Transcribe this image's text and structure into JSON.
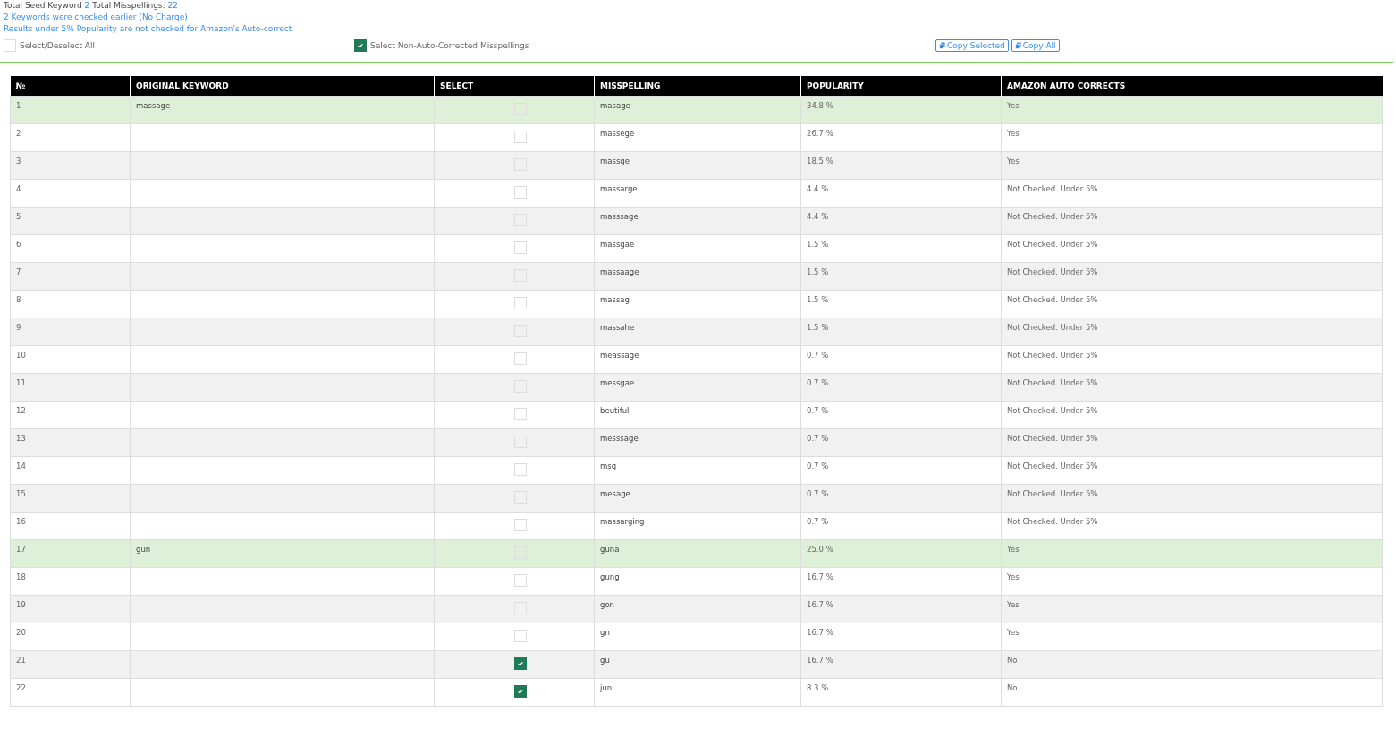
{
  "summary": {
    "seed_label": "Total Seed Keyword",
    "seed_count": "2",
    "total_label": "Total Misspellings:",
    "total_count": "22"
  },
  "notes": [
    "2 Keywords were checked earlier (No Charge)",
    "Results under 5% Popularity are not checked for Amazon's Auto-correct"
  ],
  "controls": {
    "select_all": {
      "label": "Select/Deselect All",
      "checked": false
    },
    "select_non_auto": {
      "label": "Select Non-Auto-Corrected Misspellings",
      "checked": true
    },
    "buttons": [
      "Copy Selected",
      "Copy All"
    ]
  },
  "table": {
    "columns": [
      "№",
      "ORIGINAL KEYWORD",
      "SELECT",
      "MISSPELLING",
      "POPULARITY",
      "AMAZON AUTO CORRECTS"
    ],
    "rows": [
      {
        "no": "1",
        "keyword": "massage",
        "checked": false,
        "misspelling": "masage",
        "popularity": "34.8 %",
        "auto_corrects": "Yes",
        "highlighted": true
      },
      {
        "no": "2",
        "checked": false,
        "misspelling": "massege",
        "popularity": "26.7 %",
        "auto_corrects": "Yes",
        "highlighted": false
      },
      {
        "no": "3",
        "checked": false,
        "misspelling": "massge",
        "popularity": "18.5 %",
        "auto_corrects": "Yes",
        "highlighted": false
      },
      {
        "no": "4",
        "checked": false,
        "misspelling": "massarge",
        "popularity": "4.4 %",
        "auto_corrects": "Not Checked. Under 5%",
        "highlighted": false
      },
      {
        "no": "5",
        "checked": false,
        "misspelling": "masssage",
        "popularity": "4.4 %",
        "auto_corrects": "Not Checked. Under 5%",
        "highlighted": false
      },
      {
        "no": "6",
        "checked": false,
        "misspelling": "massgae",
        "popularity": "1.5 %",
        "auto_corrects": "Not Checked. Under 5%",
        "highlighted": false
      },
      {
        "no": "7",
        "checked": false,
        "misspelling": "massaage",
        "popularity": "1.5 %",
        "auto_corrects": "Not Checked. Under 5%",
        "highlighted": false
      },
      {
        "no": "8",
        "checked": false,
        "misspelling": "massag",
        "popularity": "1.5 %",
        "auto_corrects": "Not Checked. Under 5%",
        "highlighted": false
      },
      {
        "no": "9",
        "checked": false,
        "misspelling": "massahe",
        "popularity": "1.5 %",
        "auto_corrects": "Not Checked. Under 5%",
        "highlighted": false
      },
      {
        "no": "10",
        "checked": false,
        "misspelling": "meassage",
        "popularity": "0.7 %",
        "auto_corrects": "Not Checked. Under 5%",
        "highlighted": false
      },
      {
        "no": "11",
        "checked": false,
        "misspelling": "messgae",
        "popularity": "0.7 %",
        "auto_corrects": "Not Checked. Under 5%",
        "highlighted": false
      },
      {
        "no": "12",
        "checked": false,
        "misspelling": "beutiful",
        "popularity": "0.7 %",
        "auto_corrects": "Not Checked. Under 5%",
        "highlighted": false
      },
      {
        "no": "13",
        "checked": false,
        "misspelling": "messsage",
        "popularity": "0.7 %",
        "auto_corrects": "Not Checked. Under 5%",
        "highlighted": false
      },
      {
        "no": "14",
        "checked": false,
        "misspelling": "msg",
        "popularity": "0.7 %",
        "auto_corrects": "Not Checked. Under 5%",
        "highlighted": false
      },
      {
        "no": "15",
        "checked": false,
        "misspelling": "mesage",
        "popularity": "0.7 %",
        "auto_corrects": "Not Checked. Under 5%",
        "highlighted": false
      },
      {
        "no": "16",
        "checked": false,
        "misspelling": "massarging",
        "popularity": "0.7 %",
        "auto_corrects": "Not Checked. Under 5%",
        "highlighted": false
      },
      {
        "no": "17",
        "keyword": "gun",
        "checked": false,
        "misspelling": "guna",
        "popularity": "25.0 %",
        "auto_corrects": "Yes",
        "highlighted": true
      },
      {
        "no": "18",
        "checked": false,
        "misspelling": "gung",
        "popularity": "16.7 %",
        "auto_corrects": "Yes",
        "highlighted": false
      },
      {
        "no": "19",
        "checked": false,
        "misspelling": "gon",
        "popularity": "16.7 %",
        "auto_corrects": "Yes",
        "highlighted": false
      },
      {
        "no": "20",
        "checked": false,
        "misspelling": "gn",
        "popularity": "16.7 %",
        "auto_corrects": "Yes",
        "highlighted": false
      },
      {
        "no": "21",
        "checked": true,
        "misspelling": "gu",
        "popularity": "16.7 %",
        "auto_corrects": "No",
        "highlighted": false
      },
      {
        "no": "22",
        "checked": true,
        "misspelling": "jun",
        "popularity": "8.3 %",
        "auto_corrects": "No",
        "highlighted": false
      }
    ]
  }
}
